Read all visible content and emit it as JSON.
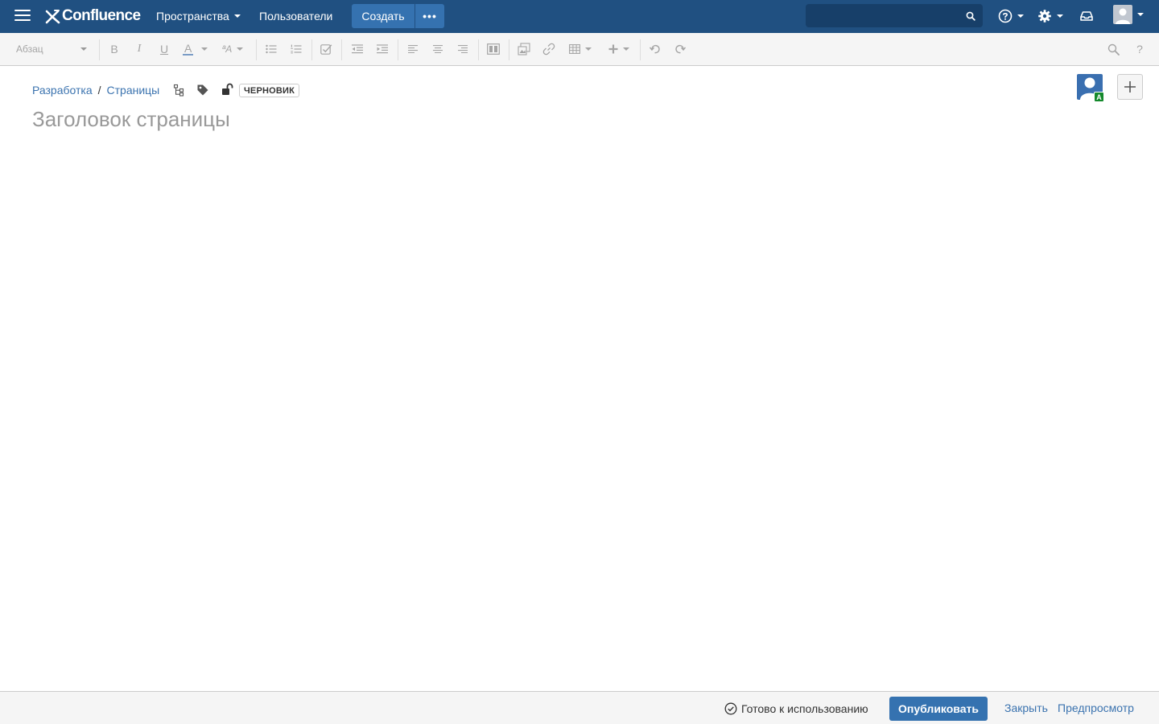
{
  "header": {
    "logo_text": "Confluence",
    "nav": {
      "spaces_label": "Пространства",
      "people_label": "Пользователи"
    },
    "create_label": "Создать",
    "more_label": "•••",
    "search": {
      "value": "",
      "placeholder": ""
    }
  },
  "toolbar": {
    "paragraph_select": "Абзац",
    "bold": "B",
    "italic": "I",
    "underline": "U",
    "text_color": "A",
    "formatting": "ªA"
  },
  "page": {
    "breadcrumbs": [
      "Разработка",
      "Страницы"
    ],
    "breadcrumb_separator": "/",
    "draft_lozenge": "ЧЕРНОВИК",
    "title_value": "",
    "title_placeholder": "Заголовок страницы",
    "avatar_badge": "A"
  },
  "footer": {
    "status": "Готово к использованию",
    "publish_label": "Опубликовать",
    "close_label": "Закрыть",
    "preview_label": "Предпросмотр"
  },
  "colors": {
    "header_bg": "#205081",
    "primary_button": "#3572b0",
    "link": "#3b73af",
    "toolbar_bg": "#f5f5f5",
    "badge_green": "#14892c"
  },
  "icons": [
    "menu-icon",
    "confluence-logo-icon",
    "search-icon",
    "help-icon",
    "settings-icon",
    "notifications-icon",
    "user-avatar-icon",
    "bullet-list-icon",
    "numbered-list-icon",
    "task-list-icon",
    "outdent-icon",
    "indent-icon",
    "align-left-icon",
    "align-center-icon",
    "align-right-icon",
    "page-layout-icon",
    "image-icon",
    "link-icon",
    "table-icon",
    "insert-plus-icon",
    "undo-icon",
    "redo-icon",
    "find-replace-icon",
    "keyboard-help-icon",
    "page-tree-icon",
    "label-icon",
    "unlock-icon",
    "add-collaborator-icon",
    "check-circle-icon"
  ]
}
